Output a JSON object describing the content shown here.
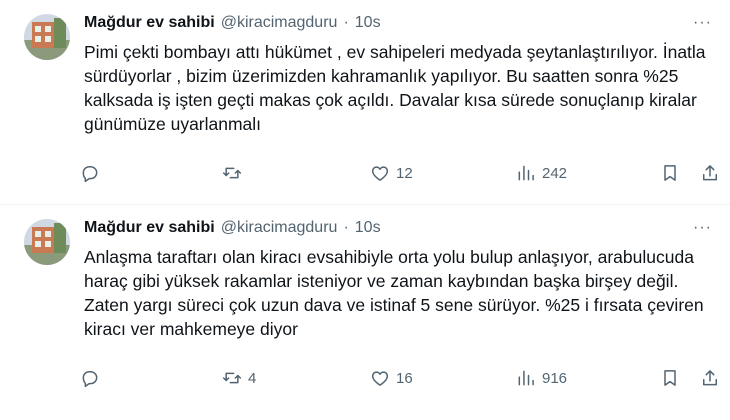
{
  "tweets": [
    {
      "name": "Mağdur ev sahibi",
      "handle": "@kiracimagduru",
      "dot": "·",
      "time": "10s",
      "more": "···",
      "text": "Pimi çekti bombayı attı hükümet , ev sahipeleri medyada şeytanlaştırılıyor. İnatla sürdüyorlar , bizim üzerimizden kahramanlık yapılıyor. Bu saatten sonra %25 kalksada iş işten geçti makas çok açıldı. Davalar kısa sürede sonuçlanıp kiralar günümüze uyarlanmalı",
      "replies": "",
      "retweets": "",
      "likes": "12",
      "views": "242",
      "icons": [
        "reply-icon",
        "retweet-icon",
        "like-icon",
        "views-icon",
        "bookmark-icon",
        "share-icon"
      ]
    },
    {
      "name": "Mağdur ev sahibi",
      "handle": "@kiracimagduru",
      "dot": "·",
      "time": "10s",
      "more": "···",
      "text": "Anlaşma taraftarı olan kiracı evsahibiyle orta yolu bulup anlaşıyor, arabulucuda haraç gibi yüksek rakamlar isteniyor ve zaman kaybından başka birşey değil. Zaten yargı süreci çok uzun dava ve istinaf 5 sene sürüyor.  %25 i fırsata çeviren kiracı ver mahkemeye diyor",
      "replies": "",
      "retweets": "4",
      "likes": "16",
      "views": "916",
      "icons": [
        "reply-icon",
        "retweet-icon",
        "like-icon",
        "views-icon",
        "bookmark-icon",
        "share-icon"
      ]
    }
  ],
  "colors": {
    "text": "#0f1419",
    "secondary": "#536471",
    "divider": "#eff3f4"
  }
}
